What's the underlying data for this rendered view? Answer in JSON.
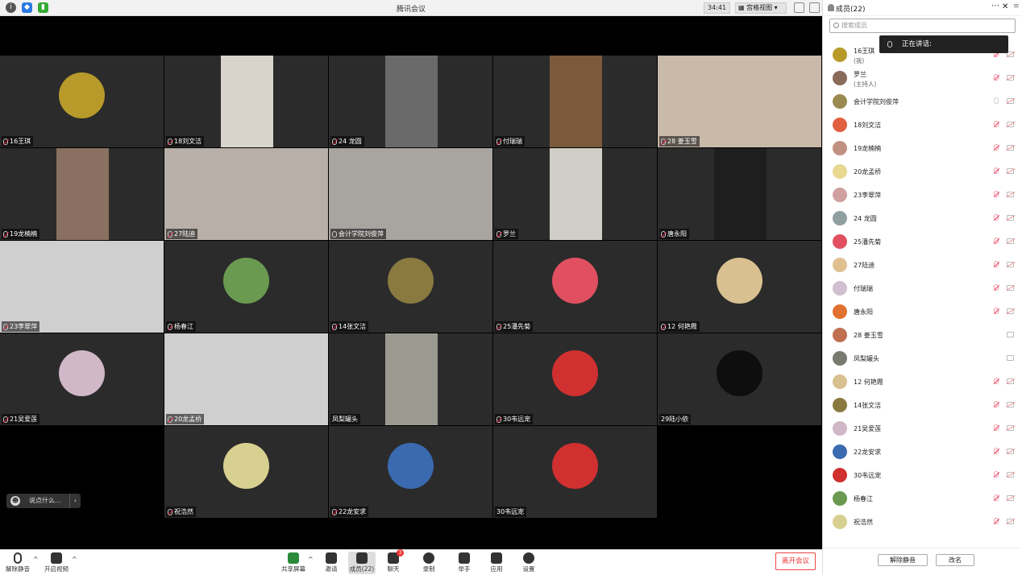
{
  "title": "腾讯会议",
  "timer": "34:41",
  "view_label": "宫格视图",
  "tiles": [
    {
      "name": "16王琪",
      "mic": "off",
      "kind": "avatar",
      "color": "#b89a2a"
    },
    {
      "name": "18刘文洁",
      "mic": "off",
      "kind": "video",
      "color": "#d8d4cc"
    },
    {
      "name": "24 龙圆",
      "mic": "off",
      "kind": "video",
      "color": "#6a6a6a"
    },
    {
      "name": "付瑞瑞",
      "mic": "off",
      "kind": "video",
      "color": "#7a5a3a"
    },
    {
      "name": "28 姜玉雪",
      "mic": "off",
      "kind": "video",
      "color": "#c9b9a9"
    },
    {
      "name": "19龙楠楠",
      "mic": "off",
      "kind": "video",
      "color": "#8a7060"
    },
    {
      "name": "27陆迪",
      "mic": "off",
      "kind": "video",
      "color": "#b8b0a8"
    },
    {
      "name": "会计学院刘俊萍",
      "mic": "on",
      "kind": "video",
      "color": "#a8a4a0"
    },
    {
      "name": "罗兰",
      "mic": "off",
      "kind": "video",
      "color": "#d0cec8"
    },
    {
      "name": "唐永阳",
      "mic": "off",
      "kind": "video",
      "color": "#1e1e1e"
    },
    {
      "name": "23李翠萍",
      "mic": "off",
      "kind": "video",
      "color": "#cfcfcf"
    },
    {
      "name": "杨春江",
      "mic": "off",
      "kind": "avatar",
      "color": "#6a9a50"
    },
    {
      "name": "14张文洁",
      "mic": "off",
      "kind": "avatar",
      "color": "#8a7a40"
    },
    {
      "name": "25潘先菊",
      "mic": "off",
      "kind": "avatar",
      "color": "#e05060"
    },
    {
      "name": "12 何艳霞",
      "mic": "off",
      "kind": "avatar",
      "color": "#d8c090"
    },
    {
      "name": "21吴爱莲",
      "mic": "off",
      "kind": "avatar",
      "color": "#d0b8c8"
    },
    {
      "name": "20龙孟桥",
      "mic": "off",
      "kind": "video",
      "color": "#cfcfcf"
    },
    {
      "name": "凤梨罐头",
      "mic": "",
      "kind": "video",
      "color": "#9a9a90"
    },
    {
      "name": "30韦远宠",
      "mic": "off",
      "kind": "avatar",
      "color": "#d03030"
    },
    {
      "name": "29陆小依",
      "mic": "",
      "kind": "avatar",
      "color": "#0e0e0e"
    },
    {
      "name": "",
      "mic": "",
      "kind": "empty",
      "color": "#000000"
    },
    {
      "name": "祝浩然",
      "mic": "off",
      "kind": "avatar",
      "color": "#d8d090"
    },
    {
      "name": "22龙安求",
      "mic": "off",
      "kind": "avatar",
      "color": "#3a6ab0"
    },
    {
      "name": "30韦远宠",
      "mic": "",
      "kind": "avatar",
      "color": "#d03030"
    }
  ],
  "chat_placeholder": "说点什么...",
  "toolbar": {
    "unmute": "解除静音",
    "video": "开启视频",
    "share": "共享屏幕",
    "invite": "邀请",
    "members": "成员(22)",
    "chat": "聊天",
    "record": "录制",
    "hand": "举手",
    "apps": "应用",
    "settings": "设置",
    "leave": "离开会议",
    "chat_badge": "3"
  },
  "panel": {
    "title": "成员(22)",
    "search_placeholder": "搜索成员",
    "speaking": "正在讲话:",
    "unmute_all": "解除静音",
    "rename": "改名"
  },
  "participants": [
    {
      "name": "16王琪",
      "sub": "(我)",
      "color": "#b89a2a"
    },
    {
      "name": "罗兰",
      "sub": "(主持人)",
      "color": "#8a6a5a"
    },
    {
      "name": "会计学院刘俊萍",
      "sub": "",
      "color": "#9a8a50",
      "mic": "on"
    },
    {
      "name": "18刘文洁",
      "sub": "",
      "color": "#e06040"
    },
    {
      "name": "19龙楠楠",
      "sub": "",
      "color": "#c09080"
    },
    {
      "name": "20龙孟桥",
      "sub": "",
      "color": "#e8d890"
    },
    {
      "name": "23李翠萍",
      "sub": "",
      "color": "#d0a0a0"
    },
    {
      "name": "24 龙圆",
      "sub": "",
      "color": "#90a0a0"
    },
    {
      "name": "25潘先菊",
      "sub": "",
      "color": "#e05060"
    },
    {
      "name": "27陆迪",
      "sub": "",
      "color": "#e0c090"
    },
    {
      "name": "付瑞瑞",
      "sub": "",
      "color": "#d0c0d0"
    },
    {
      "name": "唐永阳",
      "sub": "",
      "color": "#e07030"
    },
    {
      "name": "28 姜玉雪",
      "sub": "",
      "color": "#c07050",
      "nocam": true
    },
    {
      "name": "凤梨罐头",
      "sub": "",
      "color": "#7a7a70",
      "nocam": true
    },
    {
      "name": "12 何艳霞",
      "sub": "",
      "color": "#d8c090"
    },
    {
      "name": "14张文洁",
      "sub": "",
      "color": "#8a7a40"
    },
    {
      "name": "21吴爱莲",
      "sub": "",
      "color": "#d0b8c8"
    },
    {
      "name": "22龙安求",
      "sub": "",
      "color": "#3a6ab0"
    },
    {
      "name": "30韦远宠",
      "sub": "",
      "color": "#d03030"
    },
    {
      "name": "杨春江",
      "sub": "",
      "color": "#6a9a50"
    },
    {
      "name": "祝浩然",
      "sub": "",
      "color": "#d8d090"
    }
  ]
}
